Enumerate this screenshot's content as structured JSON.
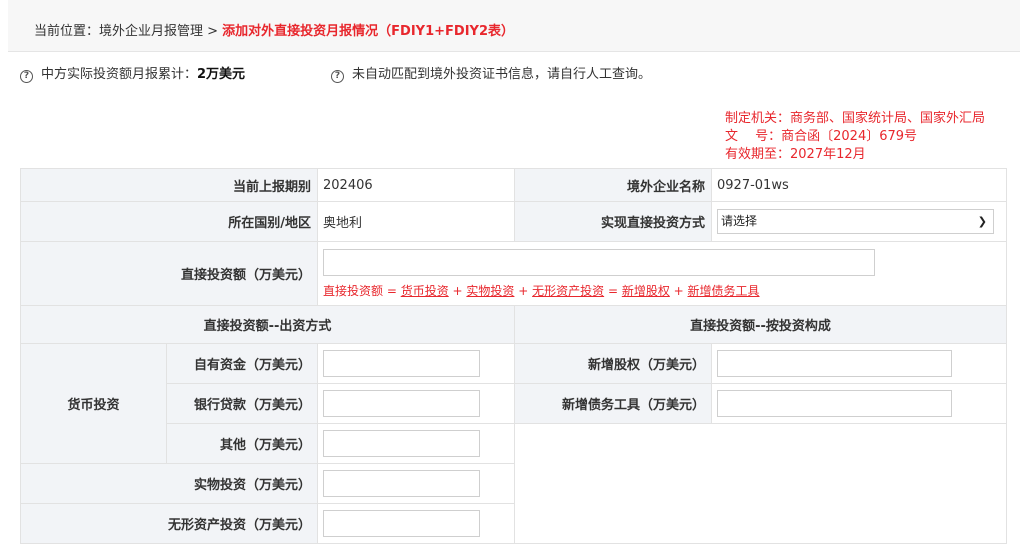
{
  "breadcrumb": {
    "prefix": "当前位置：境外企业月报管理 > ",
    "current": "添加对外直接投资月报情况（FDIY1+FDIY2表）"
  },
  "info": {
    "cumulative_label": "中方实际投资额月报累计：",
    "cumulative_value": "2万美元",
    "notice": "未自动匹配到境外投资证书信息，请自行人工查询。"
  },
  "issuer": {
    "line1": "制定机关：商务部、国家统计局、国家外汇局",
    "line2": "文　 号：商合函〔2024〕679号",
    "line3": "有效期至：2027年12月"
  },
  "fields": {
    "period_label": "当前上报期别",
    "period_value": "202406",
    "company_label": "境外企业名称",
    "company_value": "0927-01ws",
    "country_label": "所在国别/地区",
    "country_value": "奥地利",
    "method_label": "实现直接投资方式",
    "method_value": "请选择",
    "amount_label": "直接投资额（万美元）",
    "amount_value": ""
  },
  "formula": {
    "head": "直接投资额 = ",
    "t1": "货币投资",
    "op1": " + ",
    "t2": "实物投资",
    "op2": " + ",
    "t3": "无形资产投资",
    "op3": " = ",
    "t4": "新增股权",
    "op4": " + ",
    "t5": "新增债务工具"
  },
  "sections": {
    "left": "直接投资额--出资方式",
    "right": "直接投资额--按投资构成"
  },
  "monetary": {
    "group_label": "货币投资",
    "own_funds": "自有资金（万美元）",
    "bank_loan": "银行贷款（万美元）",
    "other": "其他（万美元）"
  },
  "physical": "实物投资（万美元）",
  "intangible": "无形资产投资（万美元）",
  "equity": "新增股权（万美元）",
  "debt": "新增债务工具（万美元）"
}
